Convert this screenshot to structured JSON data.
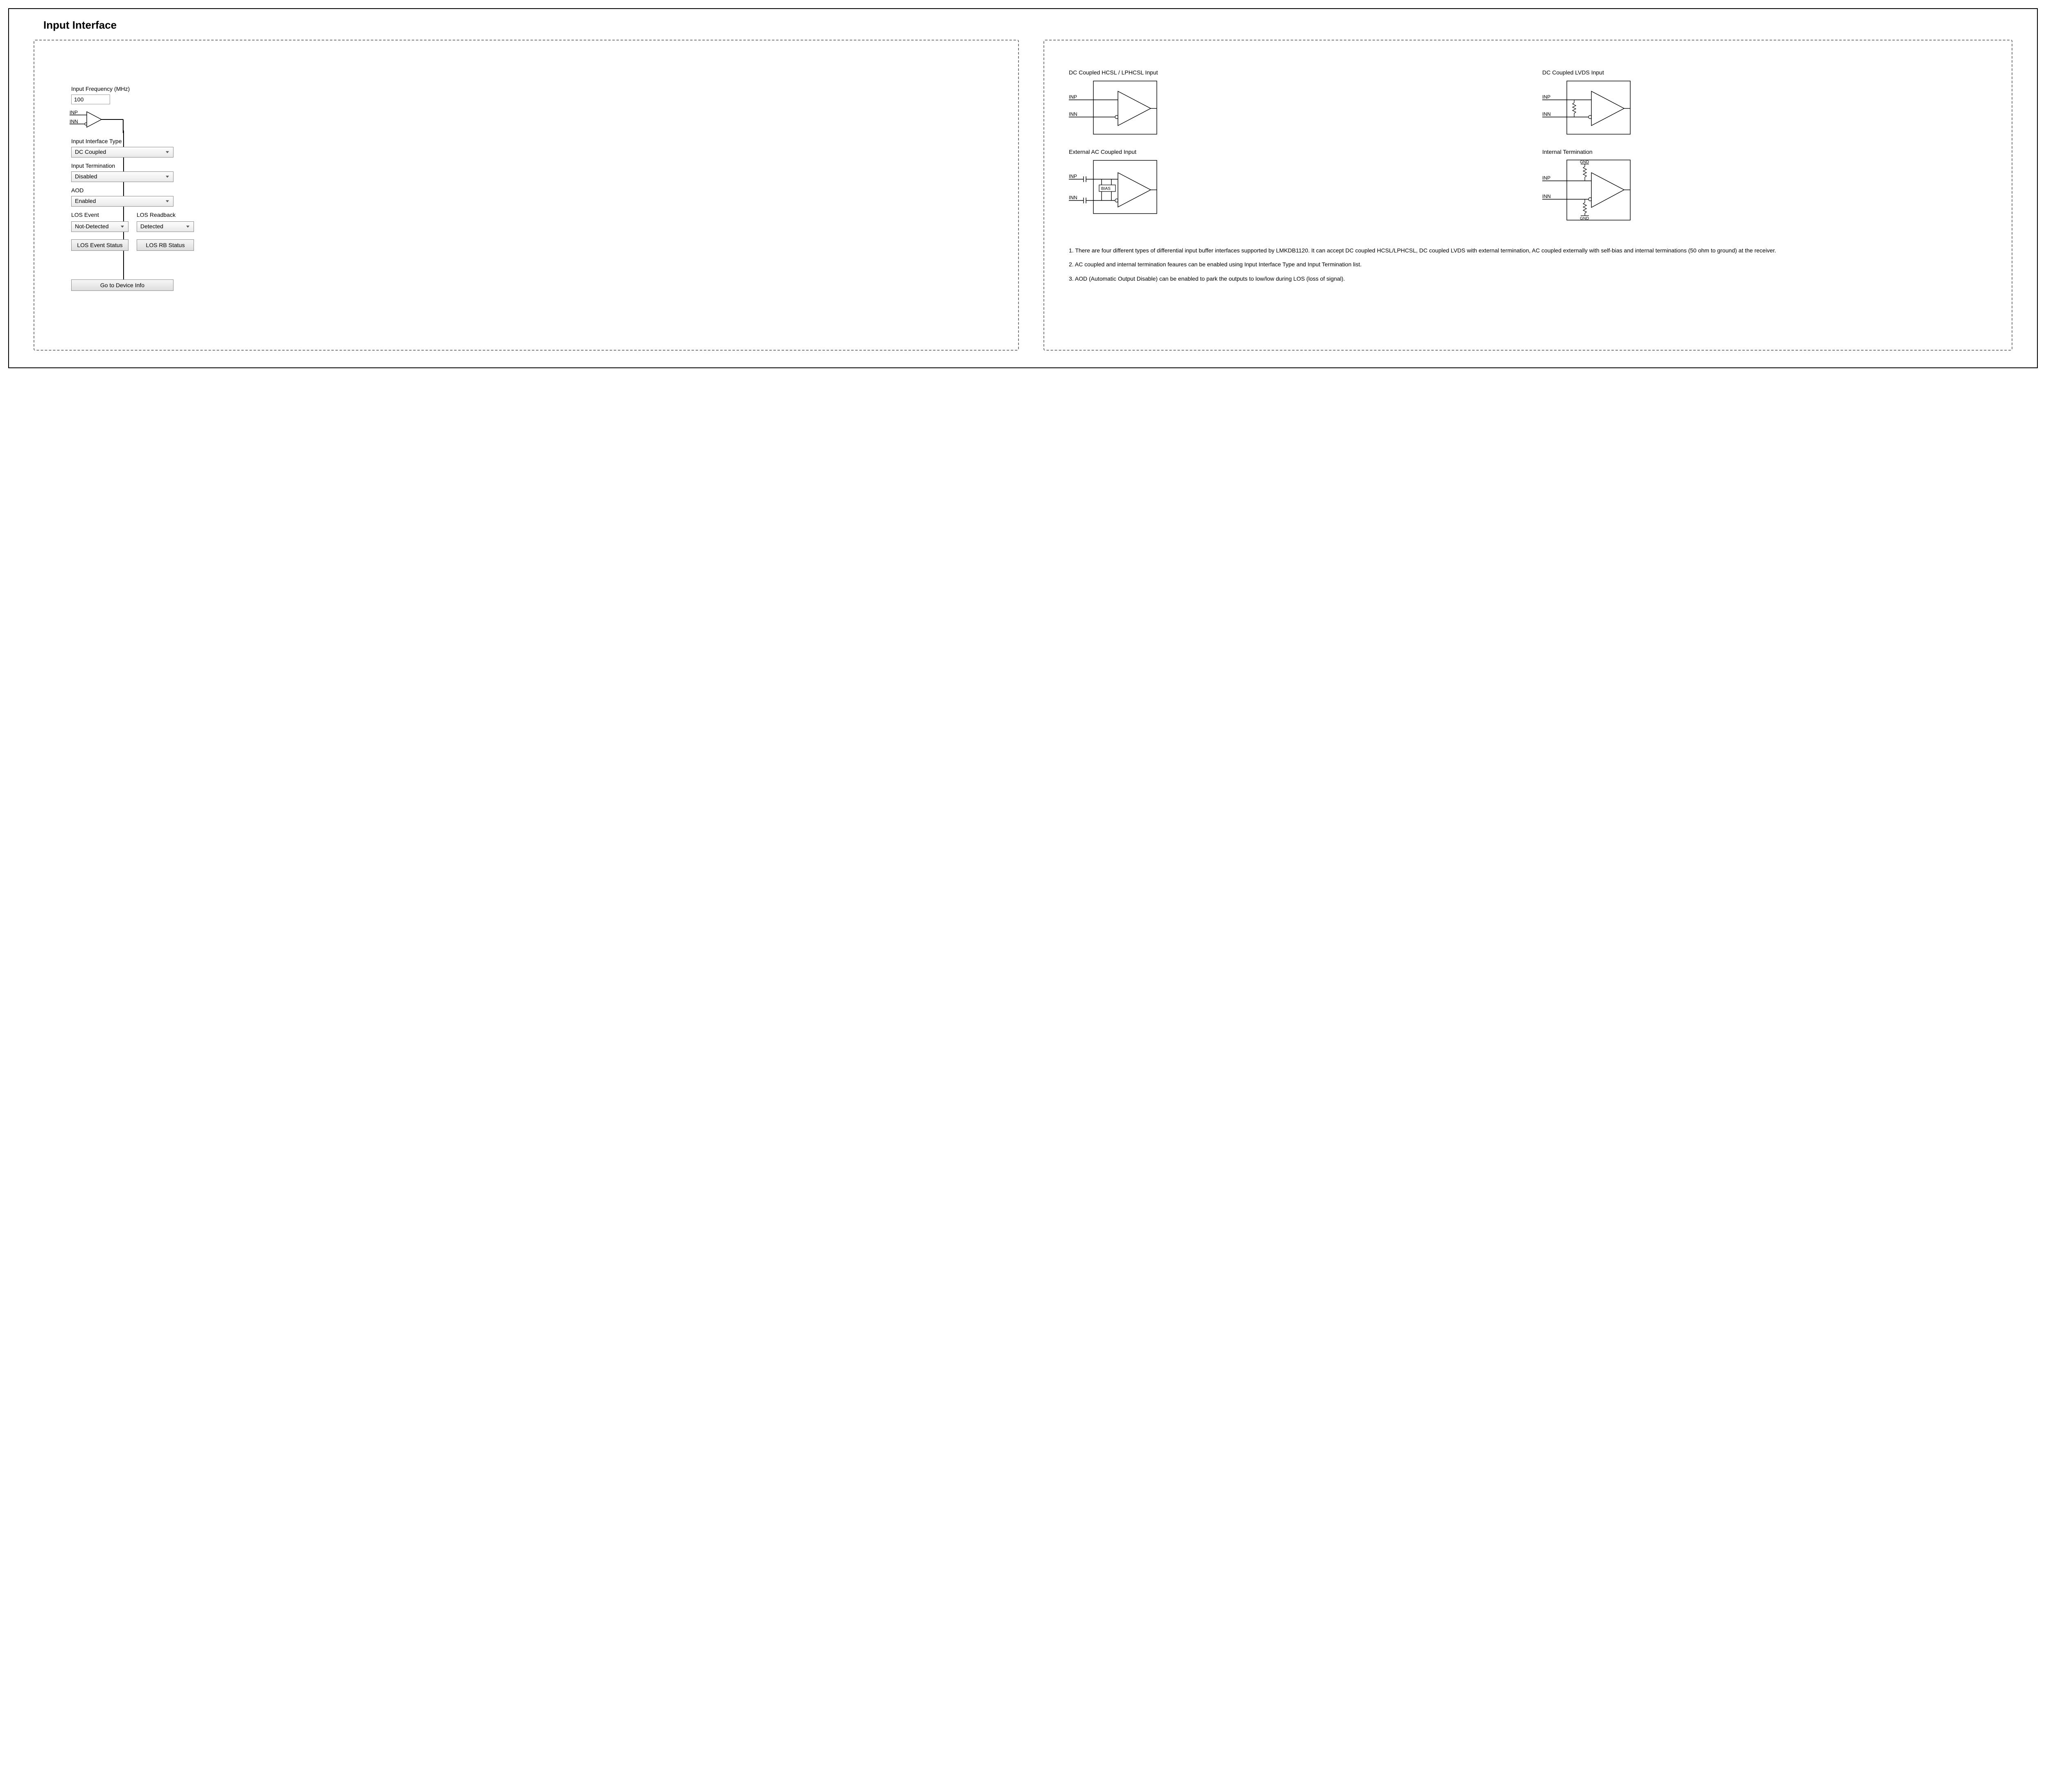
{
  "title": "Input Interface",
  "left": {
    "freq_label": "Input Frequency (MHz)",
    "freq_value": "100",
    "inp_pin": "INP",
    "inn_pin": "INN",
    "iface_type_label": "Input Interface Type",
    "iface_type_value": "DC Coupled",
    "term_label": "Input Termination",
    "term_value": "Disabled",
    "aod_label": "AOD",
    "aod_value": "Enabled",
    "los_event_label": "LOS Event",
    "los_event_value": "Not-Detected",
    "los_rb_label": "LOS Readback",
    "los_rb_value": "Detected",
    "los_event_btn": "LOS Event Status",
    "los_rb_btn": "LOS RB Status",
    "goto_btn": "Go to Device Info"
  },
  "right": {
    "diag1_title": "DC Coupled HCSL / LPHCSL Input",
    "diag2_title": "DC Coupled LVDS Input",
    "diag3_title": "External AC Coupled Input",
    "diag4_title": "Internal Termination",
    "inp": "INP",
    "inn": "INN",
    "bias": "BIAS",
    "gnd": "GND",
    "note1": "1. There are four different  types of differential input buffer interfaces supported by LMKDB1120. It can accept DC coupled HCSL/LPHCSL, DC coupled LVDS with external termination, AC coupled externally with self-bias and internal terminations (50 ohm to ground) at the receiver.",
    "note2": "2. AC coupled and internal termination feaures can be enabled using Input Interface Type and Input Termination list.",
    "note3": "3. AOD (Automatic Output Disable) can be enabled to park the outputs to low/low during LOS (loss of signal)."
  }
}
